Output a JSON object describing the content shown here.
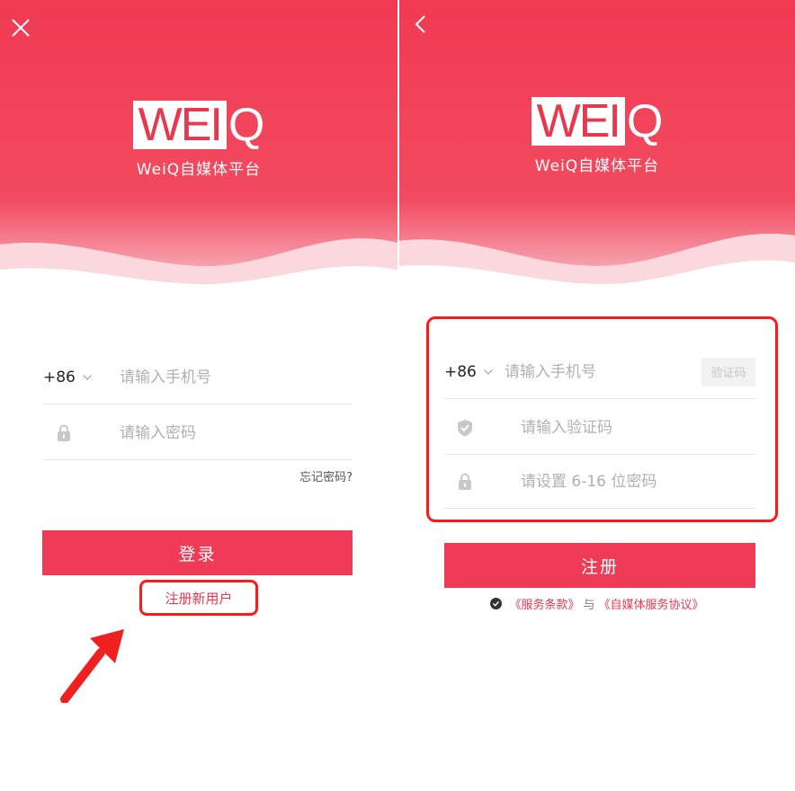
{
  "theme": {
    "accent": "#ef3b55",
    "highlight": "#ff1a1a"
  },
  "logo": {
    "mark": "WEI",
    "mark_q": "Q",
    "subtitle": "WeiQ自媒体平台"
  },
  "login": {
    "close_icon": "close-icon",
    "country_code": "+86",
    "phone_placeholder": "请输入手机号",
    "password_placeholder": "请输入密码",
    "forgot_label": "忘记密码?",
    "submit_label": "登录",
    "register_label": "注册新用户"
  },
  "register": {
    "back_icon": "chevron-left-icon",
    "country_code": "+86",
    "phone_placeholder": "请输入手机号",
    "send_code_label": "验证码",
    "code_placeholder": "请输入验证码",
    "password_placeholder": "请设置 6-16 位密码",
    "submit_label": "注册",
    "terms_service": "《服务条款》",
    "terms_and": "与",
    "terms_agreement": "《自媒体服务协议》"
  }
}
